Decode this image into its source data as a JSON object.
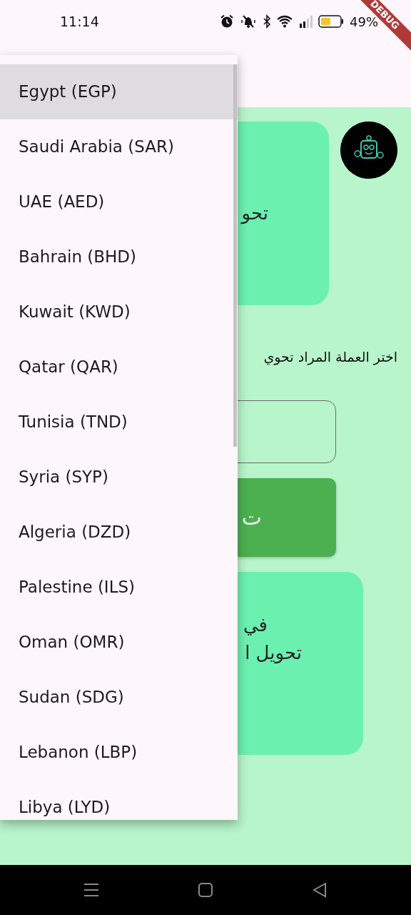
{
  "status_bar": {
    "time": "11:14",
    "battery_text": "49%"
  },
  "debug_banner": "DEBUG",
  "header_card": {
    "text": "تحو"
  },
  "currency_label": "اختر العملة المراد تحوي",
  "convert_button": "ت",
  "result_card": {
    "lines": [
      "في",
      "تحويل ا"
    ]
  },
  "currency_menu": {
    "items": [
      {
        "label": "Egypt (EGP)",
        "selected": true
      },
      {
        "label": "Saudi Arabia (SAR)",
        "selected": false
      },
      {
        "label": "UAE (AED)",
        "selected": false
      },
      {
        "label": "Bahrain (BHD)",
        "selected": false
      },
      {
        "label": "Kuwait (KWD)",
        "selected": false
      },
      {
        "label": "Qatar (QAR)",
        "selected": false
      },
      {
        "label": "Tunisia (TND)",
        "selected": false
      },
      {
        "label": "Syria (SYP)",
        "selected": false
      },
      {
        "label": "Algeria (DZD)",
        "selected": false
      },
      {
        "label": "Palestine (ILS)",
        "selected": false
      },
      {
        "label": "Oman (OMR)",
        "selected": false
      },
      {
        "label": "Sudan (SDG)",
        "selected": false
      },
      {
        "label": "Lebanon (LBP)",
        "selected": false
      },
      {
        "label": "Libya (LYD)",
        "selected": false
      }
    ]
  }
}
